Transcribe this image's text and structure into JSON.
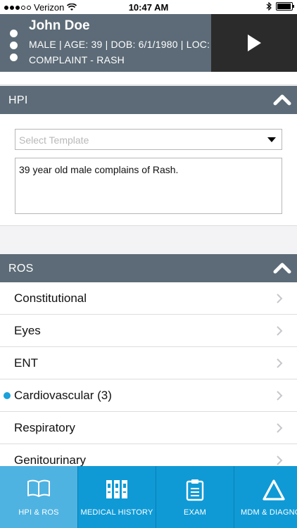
{
  "status_bar": {
    "carrier": "Verizon",
    "time": "10:47 AM",
    "signal_bars_filled": 3,
    "battery_level": 0.85
  },
  "patient": {
    "name": "John Doe",
    "demographics": "MALE | AGE: 39 | DOB: 6/1/1980 | LOC:",
    "complaint": "COMPLAINT - RASH"
  },
  "hpi": {
    "title": "HPI",
    "template_placeholder": "Select Template",
    "note_text": "39 year old male complains of Rash."
  },
  "ros": {
    "title": "ROS",
    "items": [
      {
        "label": "Constitutional"
      },
      {
        "label": "Eyes"
      },
      {
        "label": "ENT"
      },
      {
        "label": "Cardiovascular (3)"
      },
      {
        "label": "Respiratory"
      },
      {
        "label": "Genitourinary"
      }
    ]
  },
  "tabs": [
    {
      "label": "HPI & ROS",
      "icon": "book-icon"
    },
    {
      "label": "MEDICAL HISTORY",
      "icon": "binders-icon"
    },
    {
      "label": "EXAM",
      "icon": "clipboard-icon"
    },
    {
      "label": "MDM & DIAGNOS",
      "icon": "triangle-icon"
    }
  ],
  "colors": {
    "header": "#5c6b77",
    "tab_bar": "#0f9ad6",
    "tab_active": "#4fb3e2",
    "indicator": "#1ba1db"
  }
}
